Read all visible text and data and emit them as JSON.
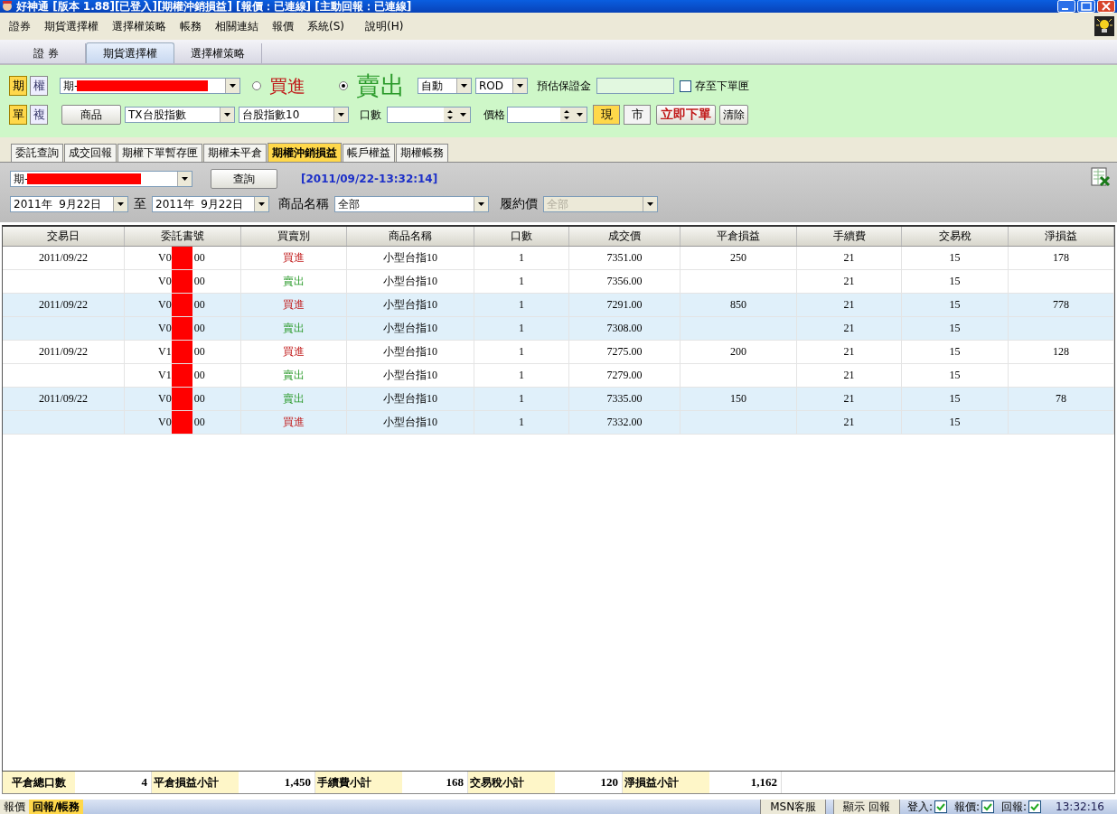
{
  "window": {
    "title": "好神通 [版本 1.88][已登入][期權沖銷損益] [報價：已連線] [主動回報：已連線]"
  },
  "menu": [
    "證券",
    "期貨選擇權",
    "選擇權策略",
    "帳務",
    "相關連結",
    "報價",
    "系統(S)",
    "說明(H)"
  ],
  "main_tabs": [
    {
      "label": "證 券",
      "selected": false
    },
    {
      "label": "期貨選擇權",
      "selected": true
    },
    {
      "label": "選擇權策略",
      "selected": false
    }
  ],
  "order_panel": {
    "market_toggle": [
      {
        "label": "期",
        "selected": true
      },
      {
        "label": "權",
        "selected": false
      }
    ],
    "mode_toggle": [
      {
        "label": "單",
        "selected": true
      },
      {
        "label": "複",
        "selected": false
      }
    ],
    "account": "期-",
    "sides": [
      {
        "label": "買進",
        "kind": "buy",
        "selected": false
      },
      {
        "label": "賣出",
        "kind": "sell",
        "selected": true
      }
    ],
    "open_close": "自動",
    "time_in_force": "ROD",
    "margin_label": "預估保證金",
    "save_label": "存至下單匣",
    "save_checked": false,
    "product_button": "商品",
    "underlying": "TX台股指數",
    "contract": "台股指數10",
    "qty_label": "口數",
    "price_label": "價格",
    "price_types": [
      {
        "label": "現",
        "selected": true
      },
      {
        "label": "市",
        "selected": false
      }
    ],
    "submit": "立即下單",
    "clear": "清除"
  },
  "sub_tabs": [
    {
      "label": "委託查詢",
      "selected": false
    },
    {
      "label": "成交回報",
      "selected": false
    },
    {
      "label": "期權下單暫存匣",
      "selected": false
    },
    {
      "label": "期權未平倉",
      "selected": false
    },
    {
      "label": "期權沖銷損益",
      "selected": true
    },
    {
      "label": "帳戶權益",
      "selected": false
    },
    {
      "label": "期權帳務",
      "selected": false
    }
  ],
  "query": {
    "account": "期-",
    "query_button": "查詢",
    "timestamp": "[2011/09/22-13:32:14]",
    "from_date": "2011年  9月22日",
    "to_label": "至",
    "to_date": "2011年  9月22日",
    "product_label": "商品名稱",
    "product": "全部",
    "strike_label": "履約價",
    "strike": "全部",
    "strike_disabled": true
  },
  "table": {
    "columns": [
      "交易日",
      "委託書號",
      "買賣別",
      "商品名稱",
      "口數",
      "成交價",
      "平倉損益",
      "手續費",
      "交易稅",
      "淨損益"
    ],
    "groups": [
      {
        "rows": [
          {
            "date": "2011/09/22",
            "order_start": "V0",
            "order_end": "00",
            "side": "買進",
            "kind": "buy",
            "product": "小型台指10",
            "qty": "1",
            "price": "7351.00",
            "pl": "250",
            "fee": "21",
            "tax": "15",
            "net": "178"
          },
          {
            "order_start": "V0",
            "order_end": "00",
            "side": "賣出",
            "kind": "sell",
            "product": "小型台指10",
            "qty": "1",
            "price": "7356.00",
            "fee": "21",
            "tax": "15"
          }
        ]
      },
      {
        "rows": [
          {
            "date": "2011/09/22",
            "order_start": "V0",
            "order_end": "00",
            "side": "買進",
            "kind": "buy",
            "product": "小型台指10",
            "qty": "1",
            "price": "7291.00",
            "pl": "850",
            "fee": "21",
            "tax": "15",
            "net": "778"
          },
          {
            "order_start": "V0",
            "order_end": "00",
            "side": "賣出",
            "kind": "sell",
            "product": "小型台指10",
            "qty": "1",
            "price": "7308.00",
            "fee": "21",
            "tax": "15"
          }
        ]
      },
      {
        "rows": [
          {
            "date": "2011/09/22",
            "order_start": "V1",
            "order_end": "00",
            "side": "買進",
            "kind": "buy",
            "product": "小型台指10",
            "qty": "1",
            "price": "7275.00",
            "pl": "200",
            "fee": "21",
            "tax": "15",
            "net": "128"
          },
          {
            "order_start": "V1",
            "order_end": "00",
            "side": "賣出",
            "kind": "sell",
            "product": "小型台指10",
            "qty": "1",
            "price": "7279.00",
            "fee": "21",
            "tax": "15"
          }
        ]
      },
      {
        "rows": [
          {
            "date": "2011/09/22",
            "order_start": "V0",
            "order_end": "00",
            "side": "賣出",
            "kind": "sell",
            "product": "小型台指10",
            "qty": "1",
            "price": "7335.00",
            "pl": "150",
            "fee": "21",
            "tax": "15",
            "net": "78"
          },
          {
            "order_start": "V0",
            "order_end": "00",
            "side": "買進",
            "kind": "buy",
            "product": "小型台指10",
            "qty": "1",
            "price": "7332.00",
            "fee": "21",
            "tax": "15"
          }
        ]
      }
    ]
  },
  "summary": [
    {
      "label": "平倉總口數",
      "value": "4"
    },
    {
      "label": "平倉損益小計",
      "value": "1,450"
    },
    {
      "label": "手續費小計",
      "value": "168"
    },
    {
      "label": "交易稅小計",
      "value": "120"
    },
    {
      "label": "淨損益小計",
      "value": "1,162"
    }
  ],
  "status_bar": {
    "tabs": [
      {
        "label": "報價",
        "selected": false
      },
      {
        "label": "回報/帳務",
        "selected": true
      }
    ],
    "buttons": [
      "MSN客服",
      "顯示 回報"
    ],
    "indicators": [
      {
        "label": "登入:",
        "checked": true
      },
      {
        "label": "報價:",
        "checked": true
      },
      {
        "label": "回報:",
        "checked": true
      }
    ],
    "time": "13:32:16"
  }
}
